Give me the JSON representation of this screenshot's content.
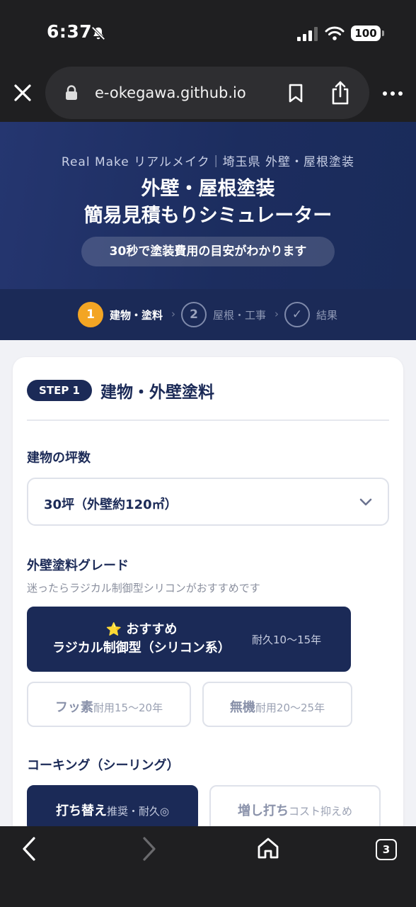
{
  "status": {
    "time": "6:37",
    "battery": "100"
  },
  "browser": {
    "url": "e-okegawa.github.io"
  },
  "hero": {
    "subtitle": "Real Make リアルメイク｜埼玉県 外壁・屋根塗装",
    "title_line1": "外壁・屋根塗装",
    "title_line2": "簡易見積もりシミュレーター",
    "badge": "30秒で塗装費用の目安がわかります"
  },
  "steps": [
    {
      "num": "1",
      "label": "建物・塗料"
    },
    {
      "num": "2",
      "label": "屋根・工事"
    },
    {
      "num": "✓",
      "label": "結果"
    }
  ],
  "card": {
    "step_pill": "STEP 1",
    "title": "建物・外壁塗料",
    "tsubo_label": "建物の坪数",
    "tsubo_value": "30坪（外壁約120㎡）",
    "grade_label": "外壁塗料グレード",
    "grade_hint": "迷ったらラジカル制御型シリコンがおすすめです",
    "grade_options": [
      {
        "badge": "⭐ おすすめ",
        "name": "ラジカル制御型（シリコン系）",
        "sub": "耐久10〜15年"
      },
      {
        "name": "フッ素",
        "sub": "耐用15〜20年"
      },
      {
        "name": "無機",
        "sub": "耐用20〜25年"
      }
    ],
    "caulking_label": "コーキング（シーリング）",
    "caulking_options": [
      {
        "name": "打ち替え",
        "sub": "推奨・耐久◎"
      },
      {
        "name": "増し打ち",
        "sub": "コスト抑えめ"
      }
    ]
  },
  "bottom": {
    "tabs_count": "3"
  },
  "colors": {
    "navy": "#1b2a57",
    "accent": "#f3a524"
  }
}
